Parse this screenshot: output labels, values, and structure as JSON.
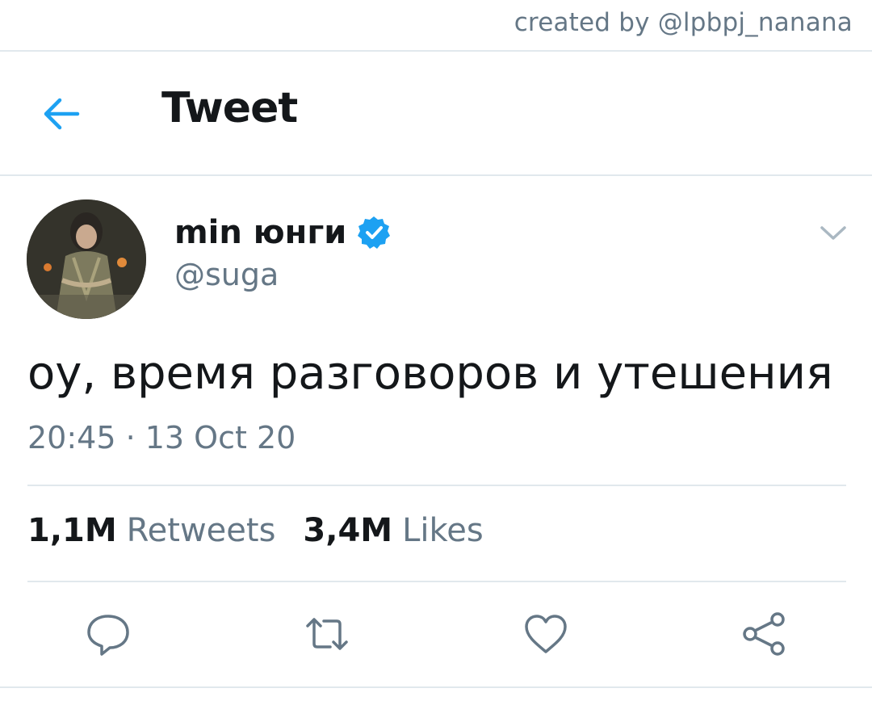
{
  "watermark": "created by @lpbpj_nanana",
  "header": {
    "title": "Tweet",
    "back_icon": "arrow-left-icon"
  },
  "tweet": {
    "author": {
      "display_name": "min юнги",
      "handle": "@suga",
      "verified": true,
      "avatar_icon": "avatar-photo"
    },
    "text": "оу, время разговоров и утешения",
    "timestamp": "20:45 · 13 Oct 20",
    "stats": {
      "retweets_count": "1,1M",
      "retweets_label": "Retweets",
      "likes_count": "3,4M",
      "likes_label": "Likes"
    },
    "actions": [
      "reply-icon",
      "retweet-icon",
      "like-icon",
      "share-icon"
    ]
  },
  "colors": {
    "accent": "#1da1f2",
    "text_primary": "#14171a",
    "text_secondary": "#657786",
    "divider": "#e1e8ed"
  }
}
